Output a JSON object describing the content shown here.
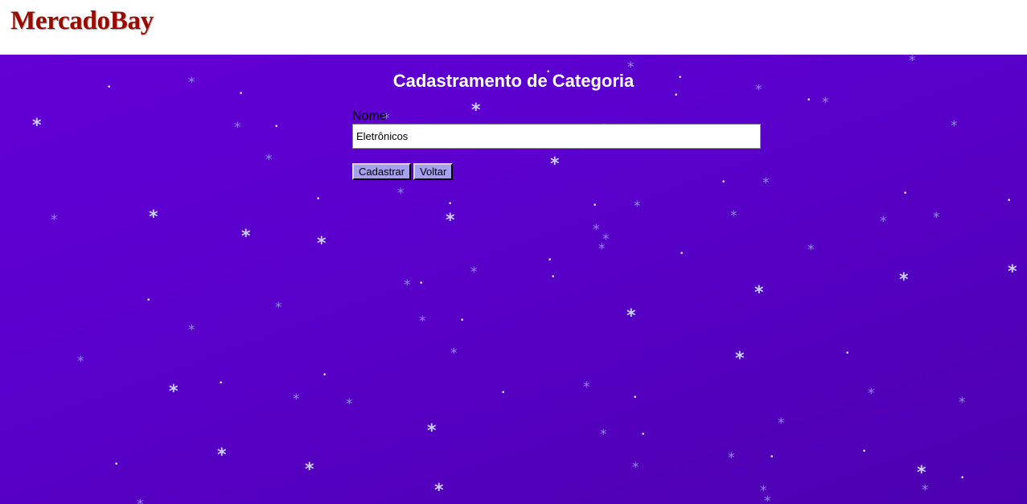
{
  "header": {
    "brand": "MercadoBay"
  },
  "page": {
    "title": "Cadastramento de Categoria"
  },
  "form": {
    "name_label": "Nome",
    "name_value": "Eletrônicos",
    "submit_label": "Cadastrar",
    "back_label": "Voltar"
  },
  "colors": {
    "brand": "#9a0a00",
    "background": "#5a00cc",
    "button": "#a6a0ee"
  },
  "decoration": {
    "pattern": "snowflake-asterisk-icon"
  }
}
